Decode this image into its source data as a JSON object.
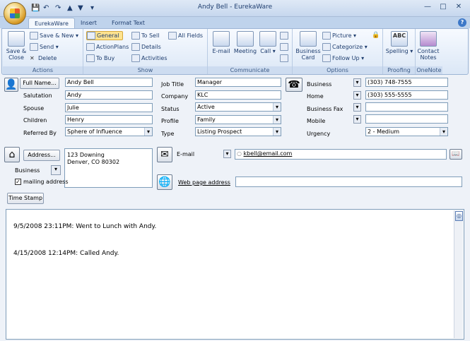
{
  "window": {
    "title": "Andy Bell - EurekaWare"
  },
  "qat": {
    "save": "💾",
    "undo": "↶",
    "redo": "↷",
    "up": "▲",
    "down": "▼",
    "more": "▾"
  },
  "winbtns": {
    "minimize": "—",
    "maximize": "□",
    "close": "✕"
  },
  "help": "?",
  "tabs": [
    {
      "label": "EurekaWare"
    },
    {
      "label": "Insert"
    },
    {
      "label": "Format Text"
    }
  ],
  "ribbon": {
    "actions": {
      "label": "Actions",
      "save_close": "Save & Close",
      "save_new": "Save & New ▾",
      "send": "Send ▾",
      "delete": "Delete"
    },
    "show": {
      "label": "Show",
      "general": "General",
      "action_plans": "ActionPlans",
      "to_buy": "To Buy",
      "to_sell": "To Sell",
      "details": "Details",
      "activities": "Activities",
      "all_fields": "All Fields"
    },
    "communicate": {
      "label": "Communicate",
      "email": "E-mail",
      "meeting": "Meeting",
      "call": "Call ▾"
    },
    "options": {
      "label": "Options",
      "business_card": "Business Card",
      "picture": "Picture ▾",
      "categorize": "Categorize ▾",
      "follow_up": "Follow Up ▾"
    },
    "proofing": {
      "label": "Proofing",
      "spelling": "Spelling ▾",
      "abc": "ABC"
    },
    "onenote": {
      "label": "OneNote",
      "contact_notes": "Contact Notes"
    }
  },
  "form": {
    "full_name_btn": "Full Name...",
    "full_name": "Andy Bell",
    "salutation_lbl": "Salutation",
    "salutation": "Andy",
    "spouse_lbl": "Spouse",
    "spouse": "Julie",
    "children_lbl": "Children",
    "children": "Henry",
    "referred_lbl": "Referred By",
    "referred": "Sphere of Influence",
    "job_title_lbl": "Job Title",
    "job_title": "Manager",
    "company_lbl": "Company",
    "company": "KLC",
    "status_lbl": "Status",
    "status": "Active",
    "profile_lbl": "Profile",
    "profile": "Family",
    "type_lbl": "Type",
    "type": "Listing Prospect",
    "business_lbl": "Business",
    "business_phone": "(303) 748-7555",
    "home_lbl": "Home",
    "home_phone": "(303) 555-5555",
    "fax_lbl": "Business Fax",
    "fax": "",
    "mobile_lbl": "Mobile",
    "mobile": "",
    "urgency_lbl": "Urgency",
    "urgency": "2 - Medium",
    "address_btn": "Address...",
    "address_line1": "123 Downing",
    "address_line2": "Denver, CO 80302",
    "address_type": "Business",
    "mailing_lbl": "mailing address",
    "checkmark": "✓",
    "email_lbl": "E-mail",
    "email": "kbell@email.com",
    "web_lbl": "Web page address",
    "web": "",
    "timestamp_btn": "Time Stamp"
  },
  "notes": [
    "9/5/2008 23:11PM:  Went to Lunch with Andy.",
    "4/15/2008 12:14PM: Called Andy."
  ]
}
